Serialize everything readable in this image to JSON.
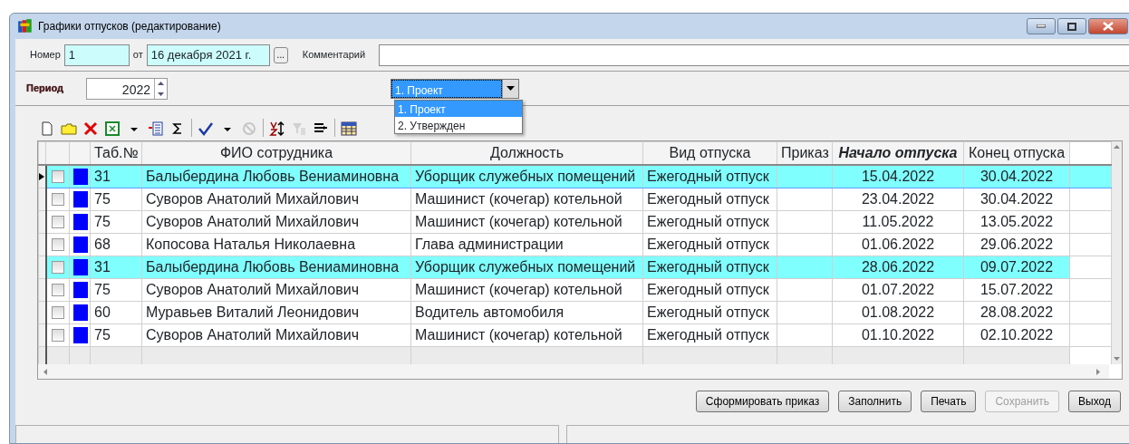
{
  "window": {
    "title": "Графики отпусков (редактирование)"
  },
  "header": {
    "number_label": "Номер",
    "number": "1",
    "date_label": "от",
    "date": "16 декабря 2021 г.",
    "date_button": "...",
    "comment_label": "Комментарий"
  },
  "period": {
    "label": "Период",
    "year": "2022"
  },
  "status_combo": {
    "value": "1. Проект",
    "expanded": true,
    "options": [
      {
        "label": "1. Проект",
        "selected": true
      },
      {
        "label": "2. Утвержден",
        "selected": false
      }
    ]
  },
  "toolbar": [
    {
      "kind": "new"
    },
    {
      "kind": "folder"
    },
    {
      "kind": "delete"
    },
    {
      "kind": "excel"
    },
    {
      "kind": "caret"
    },
    {
      "kind": "list"
    },
    {
      "kind": "sum"
    },
    {
      "kind": "sep"
    },
    {
      "kind": "check"
    },
    {
      "kind": "caret"
    },
    {
      "kind": "cancel",
      "disabled": true
    },
    {
      "kind": "sep"
    },
    {
      "kind": "sort"
    },
    {
      "kind": "filter",
      "disabled": true
    },
    {
      "kind": "columns"
    },
    {
      "kind": "sep"
    },
    {
      "kind": "table"
    }
  ],
  "table": {
    "columns": [
      {
        "label": "Таб.№",
        "sorted": false
      },
      {
        "label": "ФИО сотрудника",
        "sorted": false
      },
      {
        "label": "Должность",
        "sorted": false
      },
      {
        "label": "Вид отпуска",
        "sorted": false
      },
      {
        "label": "Приказ",
        "sorted": false
      },
      {
        "label": "Начало отпуска",
        "sorted": true
      },
      {
        "label": "Конец отпуска",
        "sorted": false
      }
    ],
    "rows": [
      {
        "current": true,
        "highlighted": true,
        "checked": false,
        "color": "#0000ff",
        "cells": [
          "31",
          "Балыбердина Любовь Вениаминовна",
          "Уборщик служебных помещений",
          "Ежегодный отпуск",
          "",
          "15.04.2022",
          "30.04.2022"
        ]
      },
      {
        "current": false,
        "highlighted": false,
        "checked": false,
        "color": "#0000ff",
        "cells": [
          "75",
          "Суворов Анатолий Михайлович",
          "Машинист (кочегар) котельной",
          "Ежегодный отпуск",
          "",
          "23.04.2022",
          "30.04.2022"
        ]
      },
      {
        "current": false,
        "highlighted": false,
        "checked": false,
        "color": "#0000ff",
        "cells": [
          "75",
          "Суворов Анатолий Михайлович",
          "Машинист (кочегар) котельной",
          "Ежегодный отпуск",
          "",
          "11.05.2022",
          "13.05.2022"
        ]
      },
      {
        "current": false,
        "highlighted": false,
        "checked": false,
        "color": "#0000ff",
        "cells": [
          "68",
          "Копосова Наталья Николаевна",
          "Глава администрации",
          "Ежегодный отпуск",
          "",
          "01.06.2022",
          "29.06.2022"
        ]
      },
      {
        "current": false,
        "highlighted": true,
        "checked": false,
        "color": "#0000ff",
        "cells": [
          "31",
          "Балыбердина Любовь Вениаминовна",
          "Уборщик служебных помещений",
          "Ежегодный отпуск",
          "",
          "28.06.2022",
          "09.07.2022"
        ]
      },
      {
        "current": false,
        "highlighted": false,
        "checked": false,
        "color": "#0000ff",
        "cells": [
          "75",
          "Суворов Анатолий Михайлович",
          "Машинист (кочегар) котельной",
          "Ежегодный отпуск",
          "",
          "01.07.2022",
          "15.07.2022"
        ]
      },
      {
        "current": false,
        "highlighted": false,
        "checked": false,
        "color": "#0000ff",
        "cells": [
          "60",
          "Муравьев Виталий Леонидович",
          "Водитель автомобиля",
          "Ежегодный отпуск",
          "",
          "01.08.2022",
          "28.08.2022"
        ]
      },
      {
        "current": false,
        "highlighted": false,
        "checked": false,
        "color": "#0000ff",
        "cells": [
          "75",
          "Суворов Анатолий Михайлович",
          "Машинист (кочегар) котельной",
          "Ежегодный отпуск",
          "",
          "01.10.2022",
          "02.10.2022"
        ]
      }
    ]
  },
  "buttons": [
    {
      "label": "Сформировать приказ",
      "disabled": false
    },
    {
      "label": "Заполнить",
      "disabled": false
    },
    {
      "label": "Печать",
      "disabled": false
    },
    {
      "label": "Сохранить",
      "disabled": true
    },
    {
      "label": "Выход",
      "disabled": false
    }
  ]
}
